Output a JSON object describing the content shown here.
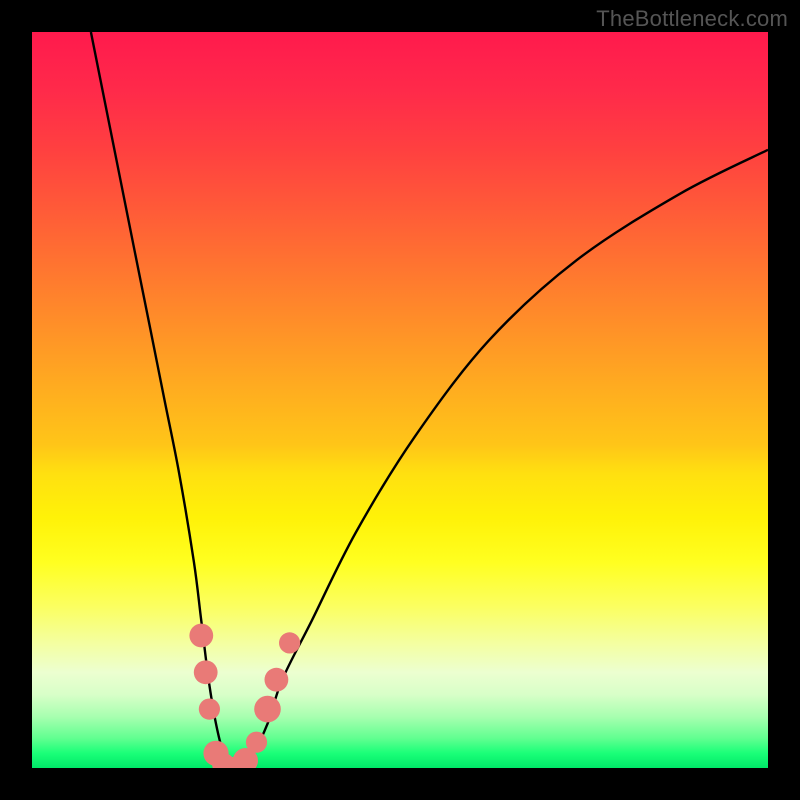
{
  "watermark": "TheBottleneck.com",
  "chart_data": {
    "type": "line",
    "title": "",
    "xlabel": "",
    "ylabel": "",
    "xlim": [
      0,
      100
    ],
    "ylim": [
      0,
      100
    ],
    "series": [
      {
        "name": "bottleneck-curve",
        "x": [
          8,
          10,
          12,
          14,
          16,
          18,
          20,
          22,
          23,
          24,
          25,
          26,
          27,
          28,
          30,
          32,
          34,
          38,
          44,
          52,
          62,
          74,
          88,
          100
        ],
        "y": [
          100,
          90,
          80,
          70,
          60,
          50,
          40,
          28,
          20,
          12,
          6,
          2,
          0,
          0,
          2,
          6,
          12,
          20,
          32,
          45,
          58,
          69,
          78,
          84
        ]
      }
    ],
    "markers": [
      {
        "name": "m1",
        "x": 23.0,
        "y": 18.0,
        "r": 1.2
      },
      {
        "name": "m2",
        "x": 23.6,
        "y": 13.0,
        "r": 1.2
      },
      {
        "name": "m3",
        "x": 24.1,
        "y": 8.0,
        "r": 1.0
      },
      {
        "name": "m4",
        "x": 25.0,
        "y": 2.0,
        "r": 1.3
      },
      {
        "name": "m5",
        "x": 26.0,
        "y": 0.5,
        "r": 1.1
      },
      {
        "name": "m6",
        "x": 27.5,
        "y": 0.0,
        "r": 1.1
      },
      {
        "name": "m7",
        "x": 29.0,
        "y": 1.0,
        "r": 1.3
      },
      {
        "name": "m8",
        "x": 30.5,
        "y": 3.5,
        "r": 1.0
      },
      {
        "name": "m9",
        "x": 32.0,
        "y": 8.0,
        "r": 1.4
      },
      {
        "name": "m10",
        "x": 33.2,
        "y": 12.0,
        "r": 1.2
      },
      {
        "name": "m11",
        "x": 35.0,
        "y": 17.0,
        "r": 1.0
      }
    ],
    "colors": {
      "curve": "#000000",
      "marker": "#e97a77"
    }
  }
}
